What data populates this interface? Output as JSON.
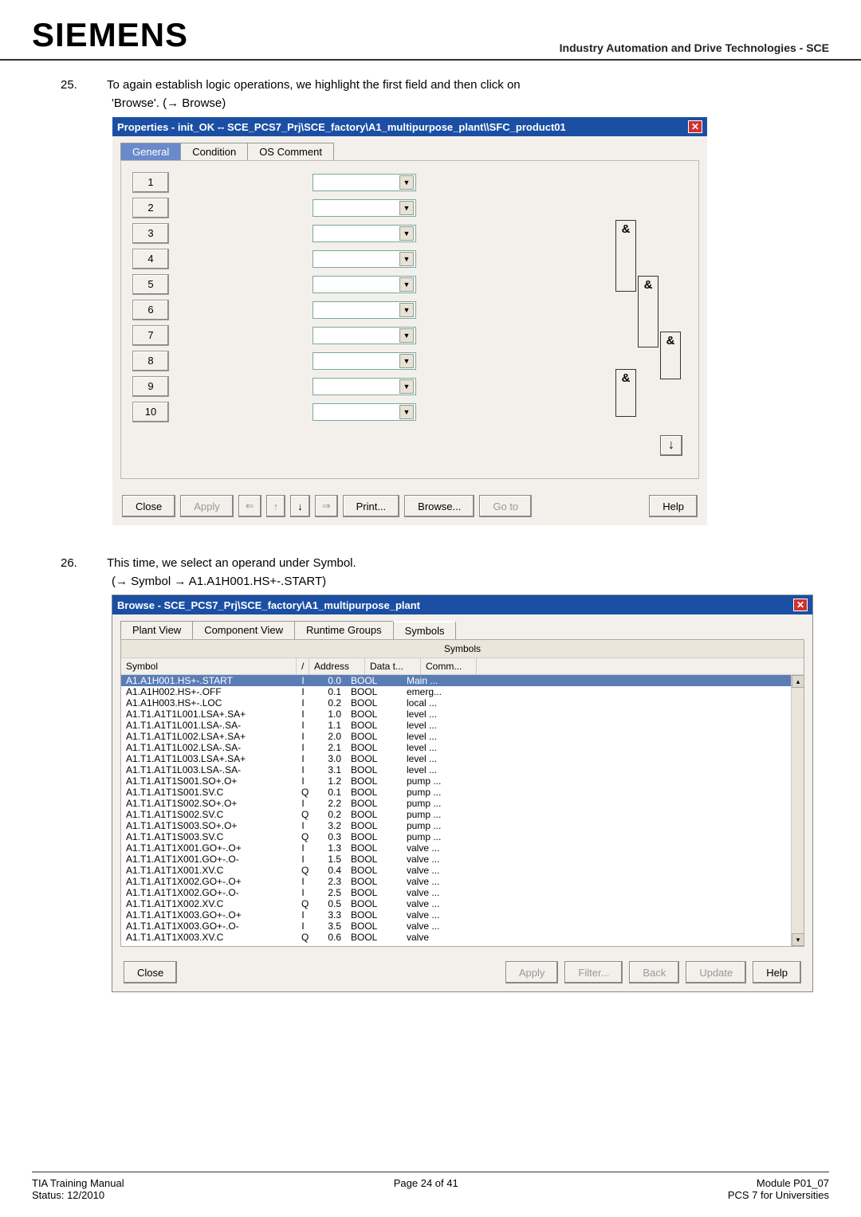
{
  "doc": {
    "brand": "SIEMENS",
    "header_right": "Industry Automation and Drive Technologies - SCE"
  },
  "step25": {
    "num": "25.",
    "text": "To again establish logic operations, we highlight the first field and then click on",
    "sub": "'Browse'. (→ Browse)"
  },
  "props": {
    "title": "Properties -  init_OK -- SCE_PCS7_Prj\\SCE_factory\\A1_multipurpose_plant\\\\SFC_product01",
    "tabs": {
      "general": "General",
      "condition": "Condition",
      "os": "OS Comment"
    },
    "rows": [
      "1",
      "2",
      "3",
      "4",
      "5",
      "6",
      "7",
      "8",
      "9",
      "10"
    ],
    "and": "&",
    "buttons": {
      "close": "Close",
      "apply": "Apply",
      "print": "Print...",
      "browse": "Browse...",
      "goto": "Go to",
      "help": "Help"
    }
  },
  "step26": {
    "num": "26.",
    "text": "This time, we select an operand under Symbol.",
    "sub": "(→ Symbol → A1.A1H001.HS+-.START)"
  },
  "browse": {
    "title": "Browse - SCE_PCS7_Prj\\SCE_factory\\A1_multipurpose_plant",
    "tabs": {
      "plant": "Plant View",
      "comp": "Component View",
      "run": "Runtime Groups",
      "sym": "Symbols"
    },
    "group": "Symbols",
    "cols": {
      "symbol": "Symbol",
      "address": "Address",
      "data": "Data t...",
      "comm": "Comm..."
    },
    "rows": [
      {
        "s": "A1.A1H001.HS+-.START",
        "p": "I",
        "a": "0.0",
        "d": "BOOL",
        "c": "Main ...",
        "sel": true
      },
      {
        "s": "A1.A1H002.HS+-.OFF",
        "p": "I",
        "a": "0.1",
        "d": "BOOL",
        "c": "emerg..."
      },
      {
        "s": "A1.A1H003.HS+-.LOC",
        "p": "I",
        "a": "0.2",
        "d": "BOOL",
        "c": "local ..."
      },
      {
        "s": "A1.T1.A1T1L001.LSA+.SA+",
        "p": "I",
        "a": "1.0",
        "d": "BOOL",
        "c": "level ..."
      },
      {
        "s": "A1.T1.A1T1L001.LSA-.SA-",
        "p": "I",
        "a": "1.1",
        "d": "BOOL",
        "c": "level ..."
      },
      {
        "s": "A1.T1.A1T1L002.LSA+.SA+",
        "p": "I",
        "a": "2.0",
        "d": "BOOL",
        "c": "level ..."
      },
      {
        "s": "A1.T1.A1T1L002.LSA-.SA-",
        "p": "I",
        "a": "2.1",
        "d": "BOOL",
        "c": "level ..."
      },
      {
        "s": "A1.T1.A1T1L003.LSA+.SA+",
        "p": "I",
        "a": "3.0",
        "d": "BOOL",
        "c": "level ..."
      },
      {
        "s": "A1.T1.A1T1L003.LSA-.SA-",
        "p": "I",
        "a": "3.1",
        "d": "BOOL",
        "c": "level ..."
      },
      {
        "s": "A1.T1.A1T1S001.SO+.O+",
        "p": "I",
        "a": "1.2",
        "d": "BOOL",
        "c": "pump ..."
      },
      {
        "s": "A1.T1.A1T1S001.SV.C",
        "p": "Q",
        "a": "0.1",
        "d": "BOOL",
        "c": "pump ..."
      },
      {
        "s": "A1.T1.A1T1S002.SO+.O+",
        "p": "I",
        "a": "2.2",
        "d": "BOOL",
        "c": "pump ..."
      },
      {
        "s": "A1.T1.A1T1S002.SV.C",
        "p": "Q",
        "a": "0.2",
        "d": "BOOL",
        "c": "pump ..."
      },
      {
        "s": "A1.T1.A1T1S003.SO+.O+",
        "p": "I",
        "a": "3.2",
        "d": "BOOL",
        "c": "pump ..."
      },
      {
        "s": "A1.T1.A1T1S003.SV.C",
        "p": "Q",
        "a": "0.3",
        "d": "BOOL",
        "c": "pump ..."
      },
      {
        "s": "A1.T1.A1T1X001.GO+-.O+",
        "p": "I",
        "a": "1.3",
        "d": "BOOL",
        "c": "valve ..."
      },
      {
        "s": "A1.T1.A1T1X001.GO+-.O-",
        "p": "I",
        "a": "1.5",
        "d": "BOOL",
        "c": "valve ..."
      },
      {
        "s": "A1.T1.A1T1X001.XV.C",
        "p": "Q",
        "a": "0.4",
        "d": "BOOL",
        "c": "valve ..."
      },
      {
        "s": "A1.T1.A1T1X002.GO+-.O+",
        "p": "I",
        "a": "2.3",
        "d": "BOOL",
        "c": "valve ..."
      },
      {
        "s": "A1.T1.A1T1X002.GO+-.O-",
        "p": "I",
        "a": "2.5",
        "d": "BOOL",
        "c": "valve ..."
      },
      {
        "s": "A1.T1.A1T1X002.XV.C",
        "p": "Q",
        "a": "0.5",
        "d": "BOOL",
        "c": "valve ..."
      },
      {
        "s": "A1.T1.A1T1X003.GO+-.O+",
        "p": "I",
        "a": "3.3",
        "d": "BOOL",
        "c": "valve ..."
      },
      {
        "s": "A1.T1.A1T1X003.GO+-.O-",
        "p": "I",
        "a": "3.5",
        "d": "BOOL",
        "c": "valve ..."
      },
      {
        "s": "A1.T1.A1T1X003.XV.C",
        "p": "Q",
        "a": "0.6",
        "d": "BOOL",
        "c": "valve"
      }
    ],
    "buttons": {
      "close": "Close",
      "apply": "Apply",
      "filter": "Filter...",
      "back": "Back",
      "update": "Update",
      "help": "Help"
    }
  },
  "footer": {
    "left1": "TIA Training Manual",
    "left2": "Status: 12/2010",
    "mid": "Page 24 of 41",
    "right1": "Module P01_07",
    "right2": "PCS 7 for Universities"
  }
}
